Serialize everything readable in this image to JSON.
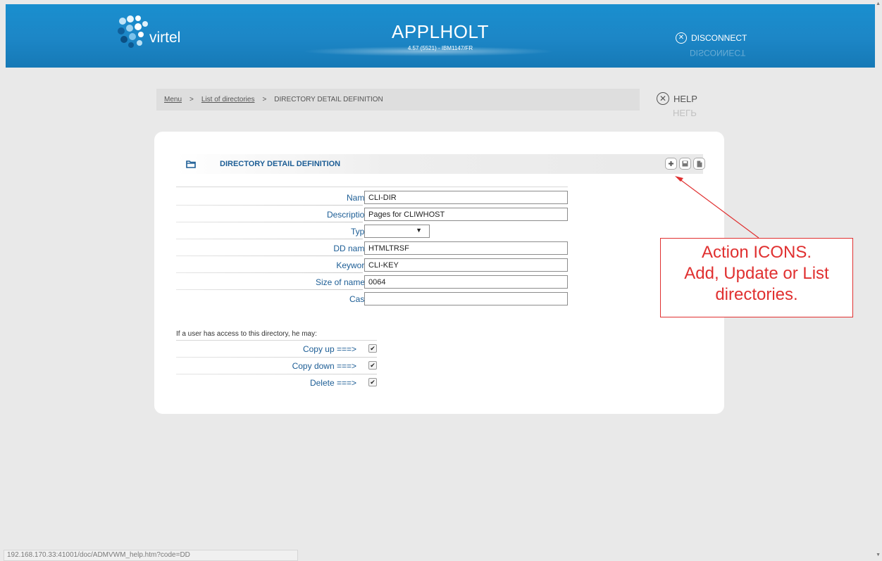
{
  "header": {
    "logo_text": "virtel",
    "app_title": "APPLHOLT",
    "app_subtitle": "4.57 (5521) - IBM1147/FR",
    "disconnect_label": "DISCONNECT"
  },
  "breadcrumb": {
    "items": [
      "Menu",
      "List of directories",
      "DIRECTORY DETAIL DEFINITION"
    ],
    "separator": ">"
  },
  "help_label": "HELP",
  "panel": {
    "title": "DIRECTORY DETAIL DEFINITION",
    "actions": [
      "add-icon",
      "save-icon",
      "list-icon"
    ]
  },
  "form": {
    "name": {
      "label": "Name",
      "value": "CLI-DIR"
    },
    "description": {
      "label": "Description",
      "value": "Pages for CLIWHOST"
    },
    "type": {
      "label": "Type",
      "value": ""
    },
    "ddname": {
      "label": "DD name",
      "value": "HTMLTRSF"
    },
    "keyword": {
      "label": "Keyword",
      "value": "CLI-KEY"
    },
    "size": {
      "label": "Size of names",
      "value": "0064"
    },
    "case": {
      "label": "Case",
      "value": ""
    }
  },
  "access": {
    "intro": "If a user has access to this directory, he may:",
    "copy_up": {
      "label": "Copy up ===>",
      "checked": true
    },
    "copy_down": {
      "label": "Copy down ===>",
      "checked": true
    },
    "delete": {
      "label": "Delete ===>",
      "checked": true
    }
  },
  "annotation": {
    "line1": "Action ICONS.",
    "line2": "Add, Update or List",
    "line3": "directories."
  },
  "status_url": "192.168.170.33:41001/doc/ADMVWM_help.htm?code=DD",
  "colors": {
    "header": "#1a8fcf",
    "label": "#1c5d95",
    "annotation": "#e03030"
  }
}
